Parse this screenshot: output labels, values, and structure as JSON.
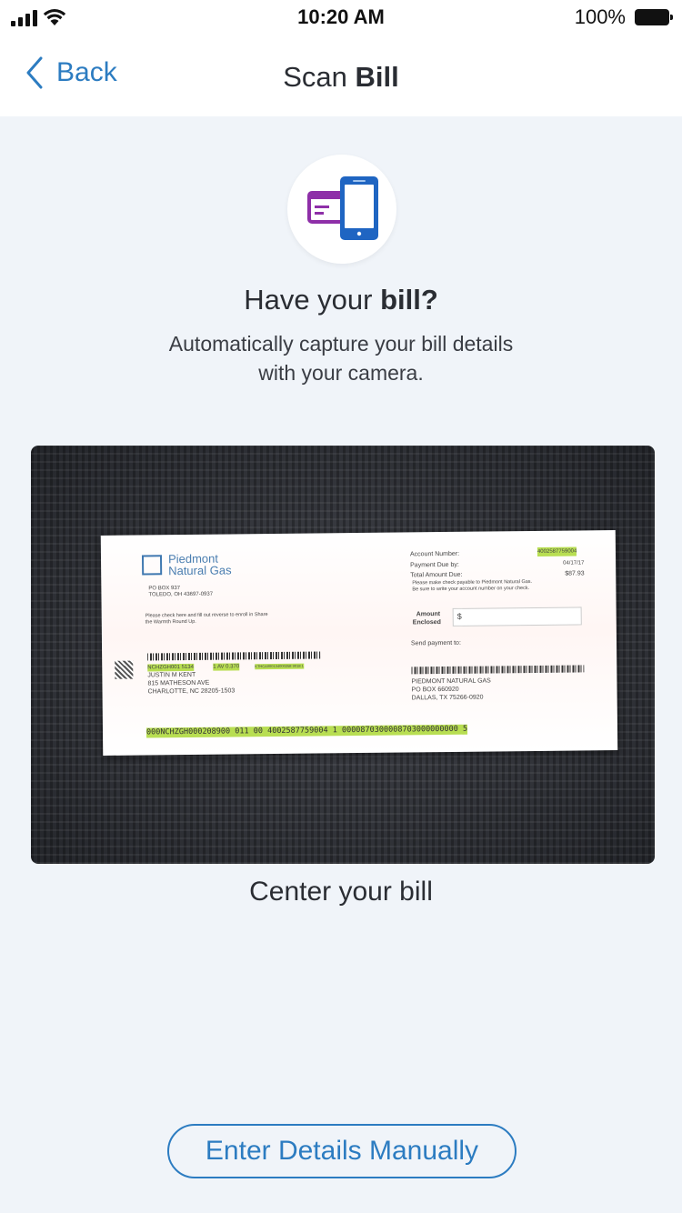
{
  "status_bar": {
    "time": "10:20 AM",
    "battery": "100%",
    "icons": [
      "signal-icon",
      "wifi-icon",
      "battery-icon"
    ]
  },
  "nav": {
    "back_label": "Back",
    "title_regular": "Scan ",
    "title_bold": "Bill"
  },
  "intro": {
    "icon": "bill-scan-icon",
    "headline_regular": "Have your ",
    "headline_bold": "bill?",
    "subtext": "Automatically capture your bill details with your camera."
  },
  "bill_preview": {
    "company": "Piedmont Natural Gas",
    "company_line1": "Piedmont",
    "company_line2": "Natural Gas",
    "po_box": "PO BOX 937",
    "city": "TOLEDO, OH 43697-0937",
    "account_number_label": "Account Number:",
    "account_number": "4002587759004",
    "payment_due_label": "Payment Due by:",
    "payment_due": "04/17/17",
    "total_due_label": "Total Amount Due:",
    "total_due": "$87.93",
    "check_note_1": "Please make check payable to Piedmont Natural Gas.",
    "check_note_2": "Be sure to write your account number on your check.",
    "share_note_1": "Please check here and fill out reverse to enroll in Share",
    "share_note_2": "the Warmth Round Up.",
    "amount_label_1": "Amount",
    "amount_label_2": "Enclosed",
    "dollar": "$",
    "send_payment": "Send payment to:",
    "customer_code": "NCHZGH001 5134",
    "customer_code2": "1 AV 0.370",
    "customer_code3": "KTHCA000134000258 9018 1",
    "customer_name": "JUSTIN M KENT",
    "customer_street": "815 MATHESON AVE",
    "customer_city": "CHARLOTTE,  NC  28205-1503",
    "remit_name": "PIEDMONT NATURAL GAS",
    "remit_box": "PO BOX 660920",
    "remit_city": "DALLAS, TX 75266-0920",
    "scan_line": "000NCHZGH000208900 011 00 4002587759004 1 0000870300008703000000000 5"
  },
  "caption": "Center your bill",
  "actions": {
    "manual_label": "Enter Details Manually"
  },
  "colors": {
    "accent": "#2c7cc1",
    "background": "#f0f4f9",
    "highlight": "#b8de52",
    "icon_purple": "#8e2fa8",
    "icon_blue": "#1f65c2"
  }
}
